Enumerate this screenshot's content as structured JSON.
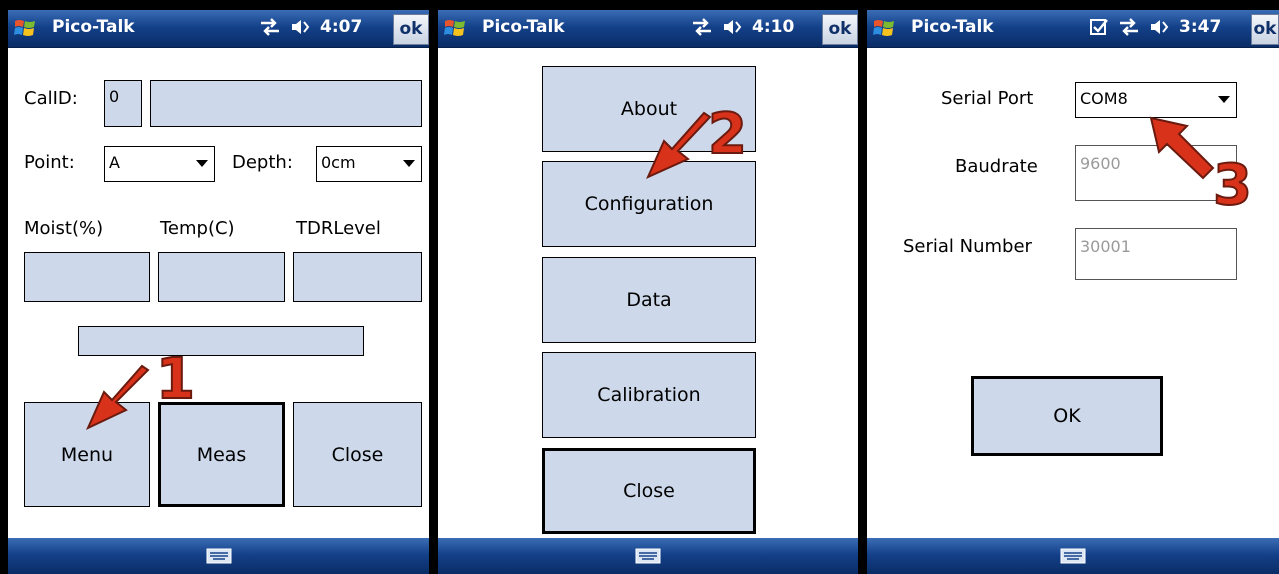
{
  "app_title": "Pico-Talk",
  "ok_label": "ok",
  "screens": [
    {
      "time": "4:07",
      "calid_label": "CalID:",
      "calid_value": "0",
      "point_label": "Point:",
      "point_value": "A",
      "depth_label": "Depth:",
      "depth_value": "0cm",
      "col_moist": "Moist(%)",
      "col_temp": "Temp(C)",
      "col_tdr": "TDRLevel",
      "buttons": {
        "menu": "Menu",
        "meas": "Meas",
        "close": "Close"
      },
      "annotation": "1"
    },
    {
      "time": "4:10",
      "buttons": {
        "about": "About",
        "configuration": "Configuration",
        "data": "Data",
        "calibration": "Calibration",
        "close": "Close"
      },
      "annotation": "2"
    },
    {
      "time": "3:47",
      "serial_port_label": "Serial Port",
      "serial_port_value": "COM8",
      "baudrate_label": "Baudrate",
      "baudrate_value": "9600",
      "serial_number_label": "Serial Number",
      "serial_number_value": "30001",
      "ok_button": "OK",
      "annotation": "3"
    }
  ],
  "icons": {
    "start": "windows-flag-icon",
    "connectivity": "connectivity-arrows-icon",
    "volume": "speaker-icon",
    "notification": "checkbox-notification-icon",
    "keyboard": "keyboard-icon"
  },
  "colors": {
    "titlebar": "#14418a",
    "control_fill": "#cdd9ea",
    "annotation_red": "#d8321b"
  }
}
